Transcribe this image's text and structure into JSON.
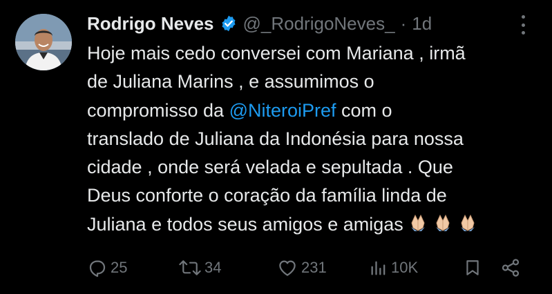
{
  "author": {
    "name": "Rodrigo Neves",
    "handle": "@_RodrigoNeves_",
    "separator": "·",
    "time": "1d",
    "verified_color": "#1d9bf0"
  },
  "tweet": {
    "lines": [
      {
        "text": "Hoje mais cedo conversei com Mariana , irmã"
      },
      {
        "text": "de Juliana Marins , e assumimos o"
      },
      {
        "before": "compromisso da ",
        "mention": "@NiteroiPref",
        "after": " com o"
      },
      {
        "text": "translado de Juliana da Indonésia para nossa"
      },
      {
        "text": "cidade , onde será velada e sepultada . Que"
      },
      {
        "text": "Deus conforte o coração da família linda de"
      },
      {
        "text": "Juliana e todos seus amigos e amigas",
        "emoji": [
          "folded-hands-icon",
          "folded-hands-icon",
          "folded-hands-icon"
        ]
      }
    ],
    "mention_color": "#1d9bf0"
  },
  "actions": {
    "replies": "25",
    "reposts": "34",
    "likes": "231",
    "views": "10K"
  },
  "icons": {
    "reply": "reply-icon",
    "repost": "repost-icon",
    "like": "heart-icon",
    "views": "analytics-icon",
    "bookmark": "bookmark-icon",
    "share": "share-icon",
    "more": "more-icon"
  },
  "colors": {
    "background": "#000000",
    "text": "#e7e9ea",
    "secondary": "#71767b",
    "accent": "#1d9bf0"
  }
}
